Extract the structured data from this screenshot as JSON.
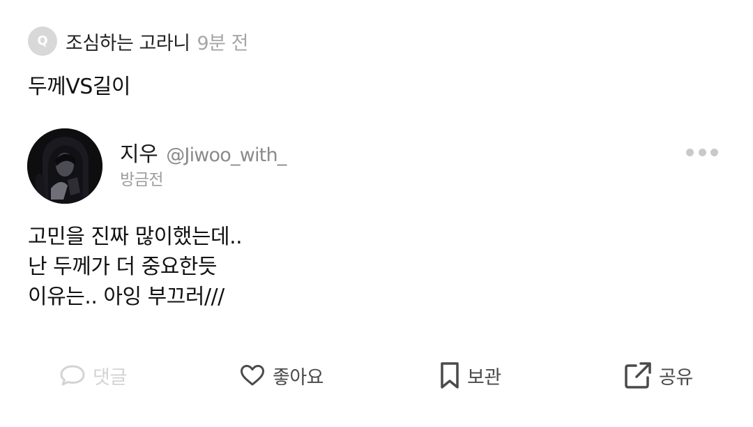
{
  "question": {
    "badge": "Q",
    "asker_name": "조심하는 고라니",
    "asked_time": "9분 전",
    "text": "두께VS길이"
  },
  "answer": {
    "author_name": "지우",
    "author_handle": "@Jiwoo_with_",
    "time": "방금전",
    "lines": [
      "고민을 진짜 많이했는데..",
      "난 두께가 더 중요한듯",
      "이유는.. 아잉 부끄러///"
    ]
  },
  "actions": {
    "comment_label": "댓글",
    "like_label": "좋아요",
    "bookmark_label": "보관",
    "share_label": "공유"
  },
  "icons": {
    "q_badge": "q-badge-icon",
    "more": "more-horizontal-icon",
    "comment": "chat-bubble-icon",
    "like": "heart-outline-icon",
    "bookmark": "bookmark-outline-icon",
    "share": "external-share-icon"
  },
  "colors": {
    "badge_bg": "#d8d8d8",
    "muted_text": "#a6a6a6",
    "handle_text": "#8a8a8a",
    "action_active": "#4a4a4a",
    "action_disabled": "#d3d3d3",
    "more_dots": "#c9c9c9"
  }
}
